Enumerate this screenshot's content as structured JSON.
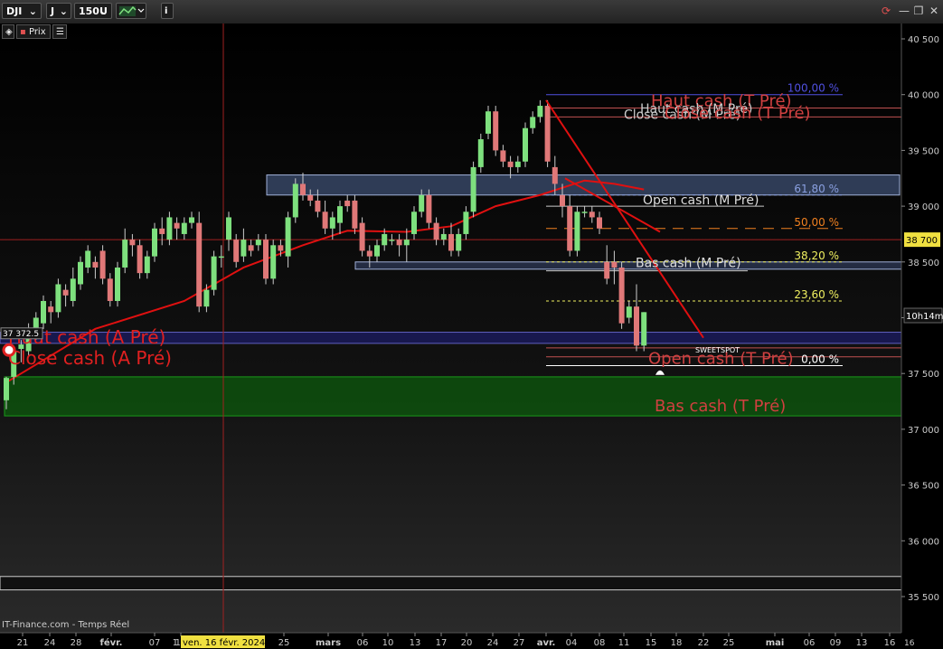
{
  "toolbar": {
    "symbol": "DJI",
    "period": "J",
    "bars": "150U",
    "info_icon": "i"
  },
  "subbar": {
    "price_label": "Prix"
  },
  "footer": "IT-Finance.com - Temps Réel",
  "colors": {
    "up": "#7ee07e",
    "down": "#e07878",
    "ma": "#e01010",
    "trend": "#e01010",
    "fib": "#f0f060",
    "pivot_label": "#d04040",
    "zone_green": "#0c5a0c",
    "zone_blue": "#3a4a6a"
  },
  "chart_data": {
    "type": "candlestick",
    "y_ticks": [
      "40 500",
      "40 000",
      "39 500",
      "39 000",
      "38 500",
      "38 000",
      "37 500",
      "37 000",
      "36 500",
      "36 000",
      "35 500"
    ],
    "x_ticks": [
      "21",
      "24",
      "28",
      "févr.",
      "07",
      "12",
      "1",
      "25",
      "mars",
      "06",
      "10",
      "13",
      "17",
      "20",
      "24",
      "27",
      "avr.",
      "04",
      "08",
      "11",
      "15",
      "18",
      "22",
      "25",
      "mai",
      "06",
      "09",
      "13",
      "16"
    ],
    "crosshair_date": "ven. 16 févr. 2024",
    "current_price_tag": "38 700",
    "timer_tag": "10h14m",
    "left_price_tag": "37 372.5",
    "ylim": [
      35400,
      40650
    ],
    "candles": [
      [
        37260,
        37460,
        37180,
        37470
      ],
      [
        37470,
        37700,
        37400,
        37720
      ],
      [
        37720,
        37760,
        37600,
        37800
      ],
      [
        37700,
        37900,
        37650,
        37950
      ],
      [
        37850,
        38000,
        37800,
        38050
      ],
      [
        37950,
        38150,
        37900,
        38200
      ],
      [
        38100,
        38050,
        37950,
        38150
      ],
      [
        38050,
        38300,
        38000,
        38350
      ],
      [
        38250,
        38200,
        38100,
        38300
      ],
      [
        38150,
        38350,
        38100,
        38450
      ],
      [
        38300,
        38500,
        38250,
        38550
      ],
      [
        38450,
        38600,
        38400,
        38650
      ],
      [
        38500,
        38450,
        38350,
        38550
      ],
      [
        38600,
        38350,
        38300,
        38650
      ],
      [
        38350,
        38150,
        38100,
        38400
      ],
      [
        38150,
        38450,
        38100,
        38500
      ],
      [
        38450,
        38700,
        38400,
        38800
      ],
      [
        38700,
        38650,
        38550,
        38750
      ],
      [
        38650,
        38400,
        38350,
        38700
      ],
      [
        38400,
        38550,
        38350,
        38600
      ],
      [
        38550,
        38800,
        38500,
        38850
      ],
      [
        38800,
        38750,
        38650,
        38900
      ],
      [
        38700,
        38900,
        38650,
        38950
      ],
      [
        38850,
        38800,
        38700,
        38900
      ],
      [
        38750,
        38850,
        38700,
        38900
      ],
      [
        38850,
        38900,
        38800,
        38950
      ],
      [
        38850,
        38100,
        38050,
        38950
      ],
      [
        38100,
        38250,
        38050,
        38300
      ],
      [
        38250,
        38550,
        38200,
        38600
      ],
      [
        38550,
        38550,
        38450,
        38650
      ],
      [
        38700,
        38900,
        38600,
        38950
      ],
      [
        38700,
        38500,
        38450,
        38750
      ],
      [
        38550,
        38700,
        38500,
        38800
      ],
      [
        38650,
        38600,
        38550,
        38700
      ],
      [
        38650,
        38700,
        38600,
        38750
      ],
      [
        38700,
        38350,
        38300,
        38750
      ],
      [
        38350,
        38650,
        38300,
        38700
      ],
      [
        38650,
        38600,
        38550,
        38700
      ],
      [
        38550,
        38900,
        38450,
        38950
      ],
      [
        38900,
        39200,
        38850,
        39250
      ],
      [
        39200,
        39100,
        39050,
        39300
      ],
      [
        39100,
        39050,
        39000,
        39150
      ],
      [
        39050,
        38950,
        38900,
        39150
      ],
      [
        38950,
        38800,
        38750,
        39050
      ],
      [
        38800,
        38900,
        38700,
        38950
      ],
      [
        38850,
        39000,
        38750,
        39050
      ],
      [
        39050,
        39000,
        38950,
        39100
      ],
      [
        39050,
        38800,
        38750,
        39100
      ],
      [
        38850,
        38600,
        38550,
        38900
      ],
      [
        38600,
        38550,
        38450,
        38650
      ],
      [
        38550,
        38650,
        38500,
        38700
      ],
      [
        38650,
        38750,
        38600,
        38800
      ],
      [
        38700,
        38700,
        38650,
        38750
      ],
      [
        38700,
        38650,
        38550,
        38750
      ],
      [
        38650,
        38700,
        38500,
        38800
      ],
      [
        38750,
        38950,
        38700,
        39000
      ],
      [
        38950,
        39100,
        38900,
        39150
      ],
      [
        39100,
        38850,
        38800,
        39150
      ],
      [
        38850,
        38700,
        38650,
        38900
      ],
      [
        38700,
        38750,
        38650,
        38800
      ],
      [
        38750,
        38600,
        38550,
        38850
      ],
      [
        38600,
        38750,
        38550,
        38800
      ],
      [
        38750,
        38950,
        38700,
        39000
      ],
      [
        38950,
        39350,
        38900,
        39400
      ],
      [
        39350,
        39600,
        39300,
        39650
      ],
      [
        39650,
        39850,
        39600,
        39900
      ],
      [
        39850,
        39500,
        39450,
        39900
      ],
      [
        39500,
        39400,
        39350,
        39550
      ],
      [
        39400,
        39350,
        39250,
        39450
      ],
      [
        39350,
        39400,
        39300,
        39450
      ],
      [
        39400,
        39700,
        39350,
        39750
      ],
      [
        39700,
        39800,
        39650,
        39850
      ],
      [
        39800,
        39900,
        39750,
        39950
      ],
      [
        39900,
        39400,
        39350,
        39950
      ],
      [
        39350,
        39200,
        39100,
        39450
      ],
      [
        39100,
        39000,
        38900,
        39200
      ],
      [
        39000,
        38600,
        38550,
        39100
      ],
      [
        38600,
        38950,
        38550,
        39000
      ],
      [
        38950,
        38950,
        38900,
        39000
      ],
      [
        38950,
        38900,
        38850,
        39000
      ],
      [
        38900,
        38800,
        38750,
        38950
      ],
      [
        38500,
        38350,
        38300,
        38650
      ],
      [
        38500,
        38450,
        38300,
        38600
      ],
      [
        38450,
        37950,
        37900,
        38500
      ],
      [
        38000,
        38100,
        37950,
        38150
      ],
      [
        38100,
        37750,
        37700,
        38300
      ],
      [
        37750,
        38050,
        37700,
        38050
      ]
    ],
    "moving_average": [
      [
        0,
        37420
      ],
      [
        12,
        37900
      ],
      [
        24,
        38150
      ],
      [
        32,
        38450
      ],
      [
        40,
        38650
      ],
      [
        46,
        38780
      ],
      [
        54,
        38770
      ],
      [
        60,
        38820
      ],
      [
        66,
        39000
      ],
      [
        72,
        39100
      ],
      [
        78,
        39230
      ],
      [
        82,
        39200
      ],
      [
        86,
        39150
      ]
    ],
    "levels": [
      {
        "name": "Haut cash (T Pré)",
        "value": 39880
      },
      {
        "name": "Haut cash (M Pré)",
        "value": 39850
      },
      {
        "name": "Close cash (M Pré)",
        "value": 39800
      },
      {
        "name": "Close cash (T Pré)",
        "value": 39810
      },
      {
        "name": "Open cash (M Pré)",
        "value": 39000
      },
      {
        "name": "Bas cash (M Pré)",
        "value": 38480
      },
      {
        "name": "Open cash (T Pré)",
        "value": 37650
      },
      {
        "name": "Bas cash (T Pré)",
        "value": 37120
      },
      {
        "name": "Haut cash (A Pré)",
        "value": 37800
      },
      {
        "name": "Close cash (A Pré)",
        "value": 37680
      }
    ],
    "fibonacci": [
      {
        "label": "100,00 %",
        "value": 40000,
        "color": "#5050e0"
      },
      {
        "label": "61,80 %",
        "value": 39100,
        "color": "#8aa0e0"
      },
      {
        "label": "50,00 %",
        "value": 38800,
        "color": "#f08020"
      },
      {
        "label": "38,20 %",
        "value": 38500,
        "color": "#f0f060"
      },
      {
        "label": "23,60 %",
        "value": 38150,
        "color": "#f0f060"
      },
      {
        "label": "0,00 %",
        "value": 37570,
        "color": "#ffffff"
      }
    ],
    "annotation": "SWEETSPOT",
    "horizontal_line": 38700
  }
}
